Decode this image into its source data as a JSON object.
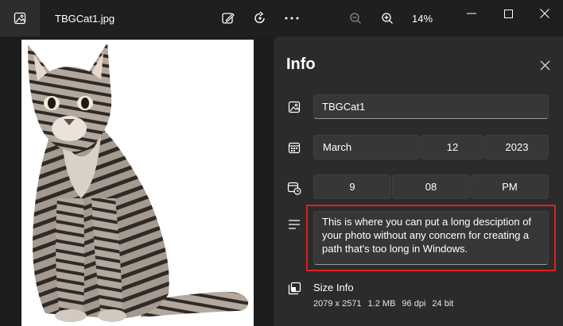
{
  "titlebar": {
    "filename": "TBGCat1.jpg",
    "zoom": "14%",
    "icons": {
      "app": "gallery-icon",
      "edit": "edit-image-icon",
      "rotate": "rotate-icon",
      "more": "more-icon",
      "zoom_out": "zoom-out-icon",
      "zoom_in": "zoom-in-icon",
      "minimize": "minimize-icon",
      "maximize": "maximize-icon",
      "close": "close-icon"
    }
  },
  "info": {
    "title": "Info",
    "name": "TBGCat1",
    "date": {
      "month": "March",
      "day": "12",
      "year": "2023"
    },
    "time": {
      "hour": "9",
      "minute": "08",
      "period": "PM"
    },
    "description": "This is where you can put a long desciption of your photo without any concern for creating a path that's too long in Windows.",
    "size_info": {
      "label": "Size Info",
      "dimensions": "2079 x 2571",
      "file_size": "1.2 MB",
      "dpi": "96 dpi",
      "bit_depth": "24 bit"
    }
  },
  "colors": {
    "background": "#202020",
    "panel": "#2b2b2b",
    "field": "#373737",
    "highlight": "#e02020"
  }
}
